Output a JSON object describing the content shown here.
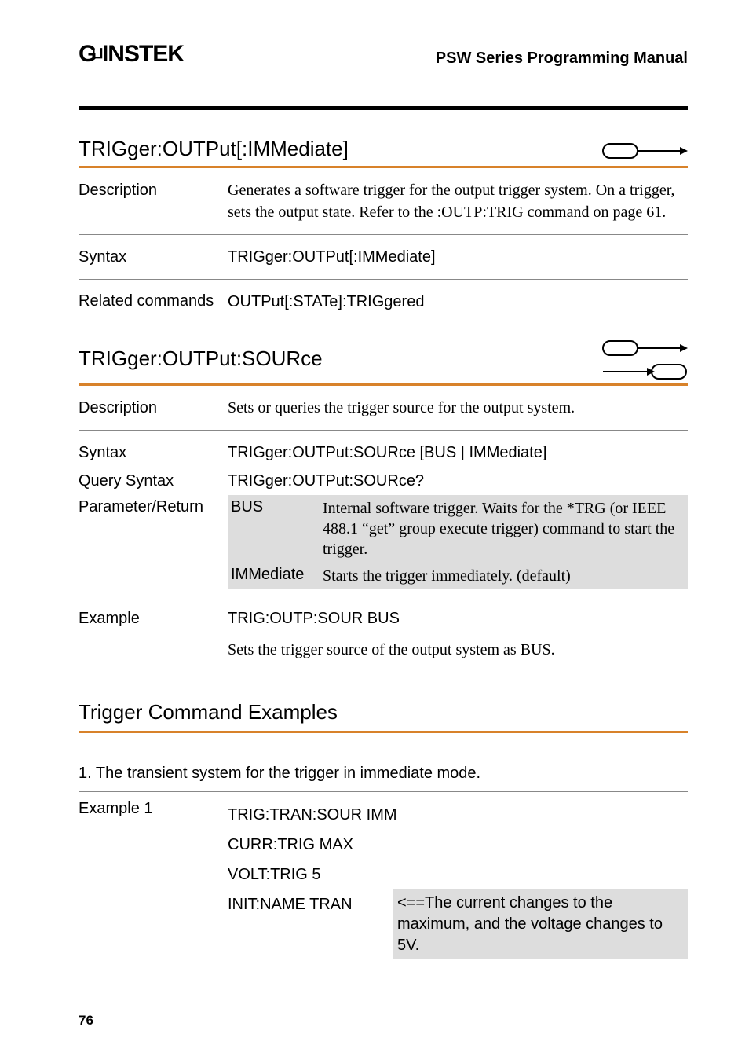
{
  "header": {
    "logo_text": "GWINSTEK",
    "manual_title": "PSW Series Programming Manual"
  },
  "sec1": {
    "heading": "TRIGger:OUTPut[:IMMediate]",
    "desc_label": "Description",
    "desc_text": "Generates a software trigger for the output trigger system. On a trigger, sets the output state. Refer to the :OUTP:TRIG command on page 61.",
    "syntax_label": "Syntax",
    "syntax_text": "TRIGger:OUTPut[:IMMediate]",
    "related_label": "Related commands",
    "related_text": "OUTPut[:STATe]:TRIGgered"
  },
  "sec2": {
    "heading": "TRIGger:OUTPut:SOURce",
    "desc_label": "Description",
    "desc_text": "Sets or queries the trigger source for the output system.",
    "syntax_label": "Syntax",
    "syntax_text": "TRIGger:OUTPut:SOURce [BUS | IMMediate]",
    "qsyntax_label": "Query Syntax",
    "qsyntax_text": "TRIGger:OUTPut:SOURce?",
    "param_label": "Parameter/Return",
    "param_bus_key": "BUS",
    "param_bus_val": "Internal software trigger. Waits for the *TRG (or IEEE 488.1 “get” group execute trigger) command to start the trigger.",
    "param_imm_key": "IMMediate",
    "param_imm_val": "Starts the trigger immediately. (default)",
    "example_label": "Example",
    "example_cmd": "TRIG:OUTP:SOUR BUS",
    "example_note": "Sets the trigger source of the output system as BUS."
  },
  "sec3": {
    "heading": "Trigger Command Examples",
    "num_line": "1.   The transient system for the trigger in immediate mode.",
    "ex_label": "Example 1",
    "cmd1": "TRIG:TRAN:SOUR IMM",
    "cmd2": "CURR:TRIG MAX",
    "cmd3": "VOLT:TRIG 5",
    "cmd4": "INIT:NAME TRAN",
    "cmd4_note": "<==The current changes to the maximum, and the voltage changes to 5V."
  },
  "page_number": "76"
}
